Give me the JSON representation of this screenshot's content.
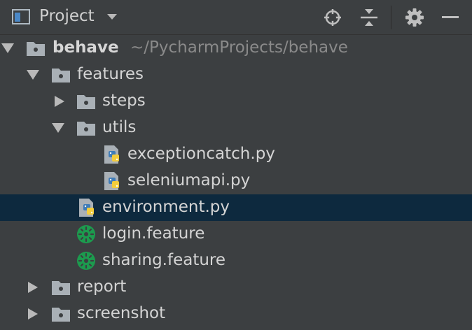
{
  "header": {
    "title": "Project",
    "icons": [
      "project-view-icon",
      "locate-icon",
      "collapse-all-icon",
      "gear-icon",
      "hide-icon"
    ]
  },
  "tree": {
    "root": {
      "label": "behave",
      "path": "~/PycharmProjects/behave"
    },
    "features": "features",
    "steps": "steps",
    "utils": "utils",
    "exceptioncatch": "exceptioncatch.py",
    "seleniumapi": "seleniumapi.py",
    "environment": "environment.py",
    "login": "login.feature",
    "sharing": "sharing.feature",
    "report": "report",
    "screenshot": "screenshot"
  },
  "colors": {
    "background": "#3c3f41",
    "selection": "#0d293e",
    "folder": "#a9b0b6",
    "python_blue": "#3f7cb8",
    "python_yellow": "#f3cc3c",
    "cucumber_green": "#1c9b4e"
  }
}
